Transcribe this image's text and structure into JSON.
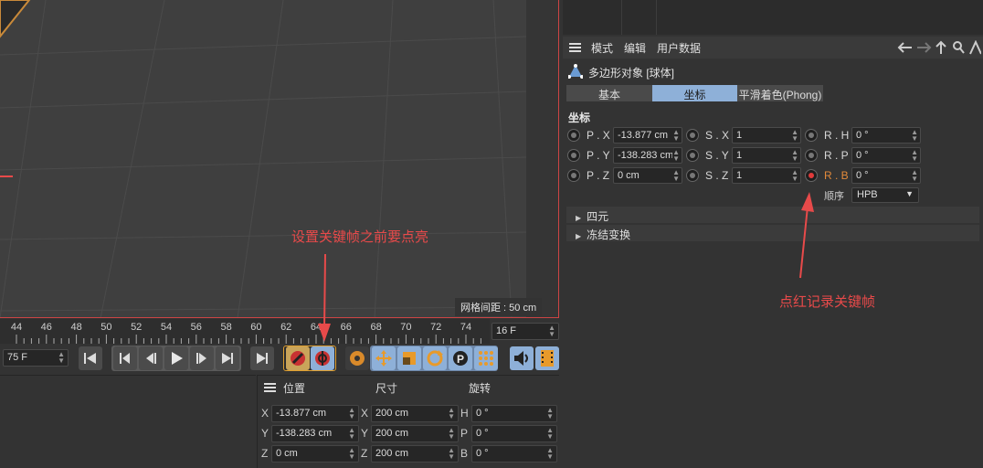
{
  "viewport": {
    "grid_spacing": "网格间距 : 50 cm"
  },
  "timeline": {
    "ticks": [
      "44",
      "46",
      "48",
      "50",
      "52",
      "54",
      "56",
      "58",
      "60",
      "62",
      "64",
      "66",
      "68",
      "70",
      "72",
      "74"
    ],
    "end_frame": "16 F",
    "current_frame": "75 F"
  },
  "transport": {
    "buttons": [
      "go-to-start",
      "previous-key",
      "play",
      "next-key",
      "go-to-end",
      "go-to-next-marker",
      "record-active-objects",
      "autokeying",
      "keyframe-selection",
      "move-key",
      "scale-key",
      "rotate-key",
      "parameter-key",
      "point-level-key",
      "sound",
      "film"
    ]
  },
  "coord_manager": {
    "headers": {
      "position": "位置",
      "size": "尺寸",
      "rotation": "旋转"
    },
    "rows": [
      {
        "pos_label": "X",
        "pos": "-13.877 cm",
        "size_label": "X",
        "size": "200 cm",
        "rot_label": "H",
        "rot": "0 °"
      },
      {
        "pos_label": "Y",
        "pos": "-138.283 cm",
        "size_label": "Y",
        "size": "200 cm",
        "rot_label": "P",
        "rot": "0 °"
      },
      {
        "pos_label": "Z",
        "pos": "0 cm",
        "size_label": "Z",
        "size": "200 cm",
        "rot_label": "B",
        "rot": "0 °"
      }
    ]
  },
  "attributes": {
    "menu": {
      "mode": "模式",
      "edit": "编辑",
      "user_data": "用户数据"
    },
    "object_title": "多边形对象 [球体]",
    "tabs": [
      {
        "label": "基本",
        "active": false
      },
      {
        "label": "坐标",
        "active": true
      },
      {
        "label": "平滑着色(Phong)",
        "active": false
      }
    ],
    "section_title": "坐标",
    "rows": [
      {
        "p_label": "P . X",
        "p_val": "-13.877 cm",
        "s_label": "S . X",
        "s_val": "1",
        "r_label": "R . H",
        "r_val": "0 °"
      },
      {
        "p_label": "P . Y",
        "p_val": "-138.283 cm",
        "s_label": "S . Y",
        "s_val": "1",
        "r_label": "R . P",
        "r_val": "0 °"
      },
      {
        "p_label": "P . Z",
        "p_val": "0 cm",
        "s_label": "S . Z",
        "s_val": "1",
        "r_label": "R . B",
        "r_val": "0 °"
      }
    ],
    "order_label": "顺序",
    "order_value": "HPB",
    "groups": [
      "四元",
      "冻结变换"
    ]
  },
  "annotations": {
    "light_up": "设置关键帧之前要点亮",
    "record": "点红记录关键帧"
  },
  "colors": {
    "accent_blue": "#8eb0d8",
    "record_red": "#e03a3a",
    "annotation_red": "#e84a4a"
  }
}
